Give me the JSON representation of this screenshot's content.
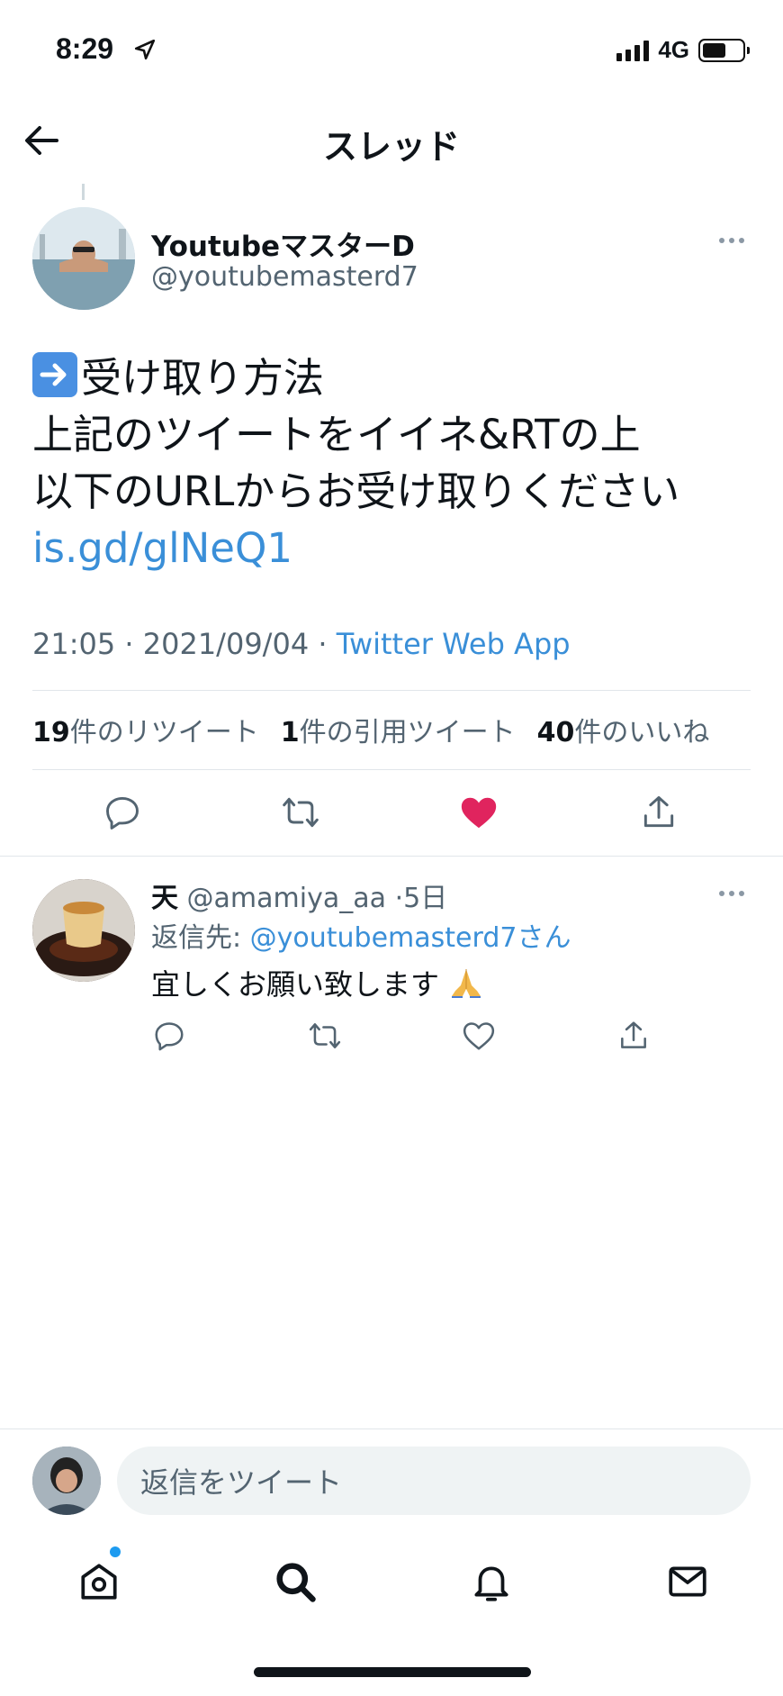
{
  "status_bar": {
    "time": "8:29",
    "network": "4G",
    "location_icon": "location-arrow-icon",
    "battery_level": 0.6
  },
  "header": {
    "title": "スレッド",
    "back_icon": "back-arrow-icon"
  },
  "tweet": {
    "author_name": "YoutubeマスターD",
    "author_handle": "@youtubemasterd7",
    "text_lines": [
      "受け取り方法",
      "上記のツイートをイイネ&RTの上",
      "以下のURLからお受け取りください"
    ],
    "emoji": "right-arrow-emoji",
    "link": "is.gd/glNeQ1",
    "time": "21:05",
    "date": "2021/09/04",
    "separator": "·",
    "source_app": "Twitter Web App",
    "stats": {
      "retweets_count": "19",
      "retweets_label": "件のリツイート",
      "quotes_count": "1",
      "quotes_label": "件の引用ツイート",
      "likes_count": "40",
      "likes_label": "件のいいね"
    },
    "liked": true
  },
  "reply": {
    "author_name": "天",
    "author_handle": "@amamiya_aa",
    "age": "5日",
    "separator": "·",
    "reply_to_label": "返信先: ",
    "reply_to_mention": "@youtubemasterd7さん",
    "text": "宜しくお願い致します",
    "emoji": "folded-hands-emoji"
  },
  "composer": {
    "placeholder": "返信をツイート"
  },
  "tabs": [
    "home-icon",
    "search-icon",
    "bell-icon",
    "mail-icon"
  ],
  "colors": {
    "link": "#3a8fd8",
    "like": "#e0245e",
    "text": "#0f1419",
    "muted": "#536471",
    "notif_dot": "#1d9bf0"
  }
}
